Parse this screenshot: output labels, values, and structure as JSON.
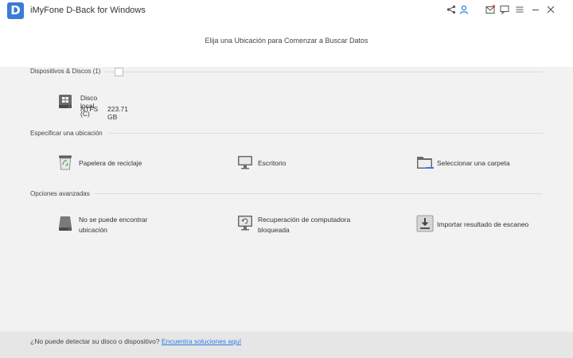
{
  "titlebar": {
    "logo_letter": "D",
    "title": "iMyFone D-Back for Windows",
    "icons": [
      "share-icon",
      "user-icon",
      "mail-icon",
      "feedback-icon",
      "menu-icon",
      "minimize-icon",
      "close-icon"
    ]
  },
  "header": {
    "instruction": "Elija una Ubicación para Comenzar a Buscar Datos"
  },
  "sections": {
    "devices": {
      "title": "Dispositivos & Discos (1)",
      "drive": {
        "name": "Disco local (C)",
        "filesystem": "NTFS",
        "size": "223.71 GB"
      }
    },
    "location": {
      "title": "Especificar una ubicación",
      "items": [
        "Papelera de reciclaje",
        "Escritorio",
        "Seleccionar una carpeta"
      ]
    },
    "advanced": {
      "title": "Opciones avanzadas",
      "items": [
        {
          "line1": "No se puede encontrar",
          "line2": "ubicación"
        },
        {
          "line1": "Recuperación de computadora",
          "line2": "bloqueada"
        },
        {
          "line1": "Importar resultado de escaneo",
          "line2": ""
        }
      ]
    }
  },
  "footer": {
    "text": "¿No puede detectar su disco o dispositivo? ",
    "link": "Encuentra soluciones aquí"
  },
  "colors": {
    "accent": "#2b7de9",
    "logo": "#3a7bd5"
  }
}
